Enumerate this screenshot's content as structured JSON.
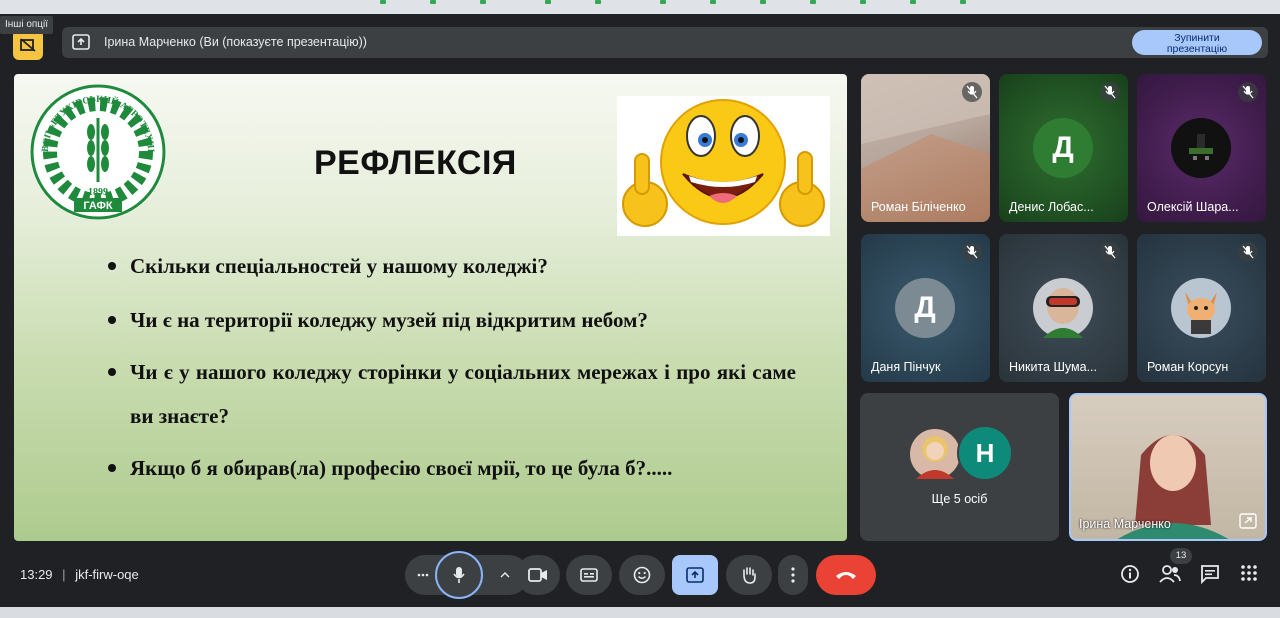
{
  "tooltip": "Інші опції",
  "presenting": {
    "text": "Ірина Марченко (Ви (показуєте презентацію))",
    "stop_line1": "Зупинити",
    "stop_line2": "презентацію"
  },
  "slide": {
    "title": "РЕФЛЕКСІЯ",
    "logo_text": "ВСП «ГЛУХІВСЬКИЙ АГРОТЕХНІЧНИЙ ФАХОВИЙ КОЛЕДЖ СНАУ»",
    "logo_year": "1899",
    "logo_abbr": "ГАФК",
    "bullets": [
      "Скільки спеціальностей у нашому коледжі?",
      "Чи є на території коледжу музей під відкритим небом?",
      "Чи є у нашого коледжу сторінки у соціальних мережах і про які саме ви знаєте?",
      "Якщо б я обирав(ла) професію своєї мрії, то це була б?....."
    ]
  },
  "participants": [
    {
      "name": "Роман Біліченко"
    },
    {
      "name": "Денис Лобас...",
      "initial": "Д"
    },
    {
      "name": "Олексій Шара..."
    },
    {
      "name": "Даня Пінчук",
      "initial": "Д"
    },
    {
      "name": "Никита Шума..."
    },
    {
      "name": "Роман Корсун"
    }
  ],
  "more": {
    "label": "Ще 5 осіб",
    "initial": "Н"
  },
  "self": {
    "name": "Ірина Марченко"
  },
  "meeting": {
    "time": "13:29",
    "code": "jkf-firw-oqe"
  },
  "people_count": "13",
  "colors": {
    "end_call": "#ea4335",
    "present_active": "#a8c7fa",
    "bar": "#3c4043"
  }
}
